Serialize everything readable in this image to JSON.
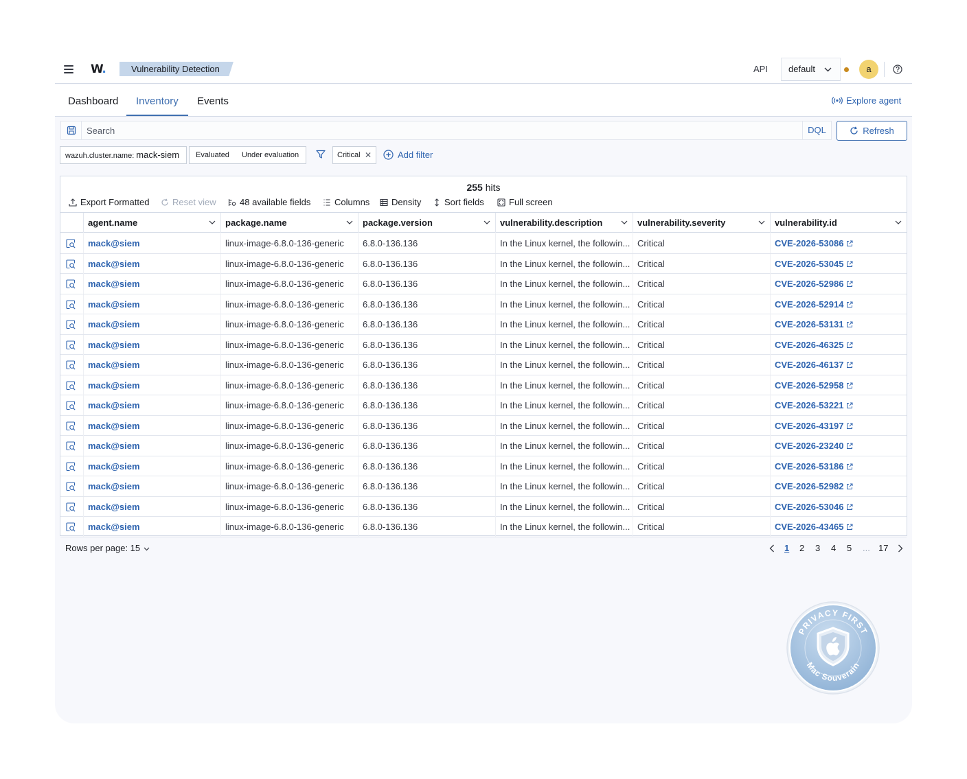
{
  "header": {
    "logo": "W",
    "breadcrumb": "Vulnerability Detection",
    "api_label": "API",
    "api_select": "default",
    "avatar_initial": "a"
  },
  "tabs": [
    {
      "label": "Dashboard"
    },
    {
      "label": "Inventory",
      "active": true
    },
    {
      "label": "Events"
    }
  ],
  "explore_agent": "Explore agent",
  "search": {
    "placeholder": "Search",
    "value": "",
    "language": "DQL"
  },
  "refresh_label": "Refresh",
  "filters": {
    "cluster_key": "wazuh.cluster.name:",
    "cluster_value": "mack-siem",
    "segment": [
      "Evaluated",
      "Under evaluation"
    ],
    "severity_pill": "Critical",
    "add_filter": "Add filter"
  },
  "grid": {
    "hits_count": "255",
    "hits_label": "hits",
    "toolbar": {
      "export": "Export Formatted",
      "reset": "Reset view",
      "fields": "48 available fields",
      "columns": "Columns",
      "density": "Density",
      "sort": "Sort fields",
      "fullscreen": "Full screen"
    },
    "columns": [
      "agent.name",
      "package.name",
      "package.version",
      "vulnerability.description",
      "vulnerability.severity",
      "vulnerability.id"
    ],
    "rows": [
      {
        "agent": "mack@siem",
        "package": "linux-image-6.8.0-136-generic",
        "version": "6.8.0-136.136",
        "description": "In the Linux kernel, the followin...",
        "severity": "Critical",
        "id": "CVE-2026-53086"
      },
      {
        "agent": "mack@siem",
        "package": "linux-image-6.8.0-136-generic",
        "version": "6.8.0-136.136",
        "description": "In the Linux kernel, the followin...",
        "severity": "Critical",
        "id": "CVE-2026-53045"
      },
      {
        "agent": "mack@siem",
        "package": "linux-image-6.8.0-136-generic",
        "version": "6.8.0-136.136",
        "description": "In the Linux kernel, the followin...",
        "severity": "Critical",
        "id": "CVE-2026-52986"
      },
      {
        "agent": "mack@siem",
        "package": "linux-image-6.8.0-136-generic",
        "version": "6.8.0-136.136",
        "description": "In the Linux kernel, the followin...",
        "severity": "Critical",
        "id": "CVE-2026-52914"
      },
      {
        "agent": "mack@siem",
        "package": "linux-image-6.8.0-136-generic",
        "version": "6.8.0-136.136",
        "description": "In the Linux kernel, the followin...",
        "severity": "Critical",
        "id": "CVE-2026-53131"
      },
      {
        "agent": "mack@siem",
        "package": "linux-image-6.8.0-136-generic",
        "version": "6.8.0-136.136",
        "description": "In the Linux kernel, the followin...",
        "severity": "Critical",
        "id": "CVE-2026-46325"
      },
      {
        "agent": "mack@siem",
        "package": "linux-image-6.8.0-136-generic",
        "version": "6.8.0-136.136",
        "description": "In the Linux kernel, the followin...",
        "severity": "Critical",
        "id": "CVE-2026-46137"
      },
      {
        "agent": "mack@siem",
        "package": "linux-image-6.8.0-136-generic",
        "version": "6.8.0-136.136",
        "description": "In the Linux kernel, the followin...",
        "severity": "Critical",
        "id": "CVE-2026-52958"
      },
      {
        "agent": "mack@siem",
        "package": "linux-image-6.8.0-136-generic",
        "version": "6.8.0-136.136",
        "description": "In the Linux kernel, the followin...",
        "severity": "Critical",
        "id": "CVE-2026-53221"
      },
      {
        "agent": "mack@siem",
        "package": "linux-image-6.8.0-136-generic",
        "version": "6.8.0-136.136",
        "description": "In the Linux kernel, the followin...",
        "severity": "Critical",
        "id": "CVE-2026-43197"
      },
      {
        "agent": "mack@siem",
        "package": "linux-image-6.8.0-136-generic",
        "version": "6.8.0-136.136",
        "description": "In the Linux kernel, the followin...",
        "severity": "Critical",
        "id": "CVE-2026-23240"
      },
      {
        "agent": "mack@siem",
        "package": "linux-image-6.8.0-136-generic",
        "version": "6.8.0-136.136",
        "description": "In the Linux kernel, the followin...",
        "severity": "Critical",
        "id": "CVE-2026-53186"
      },
      {
        "agent": "mack@siem",
        "package": "linux-image-6.8.0-136-generic",
        "version": "6.8.0-136.136",
        "description": "In the Linux kernel, the followin...",
        "severity": "Critical",
        "id": "CVE-2026-52982"
      },
      {
        "agent": "mack@siem",
        "package": "linux-image-6.8.0-136-generic",
        "version": "6.8.0-136.136",
        "description": "In the Linux kernel, the followin...",
        "severity": "Critical",
        "id": "CVE-2026-53046"
      },
      {
        "agent": "mack@siem",
        "package": "linux-image-6.8.0-136-generic",
        "version": "6.8.0-136.136",
        "description": "In the Linux kernel, the followin...",
        "severity": "Critical",
        "id": "CVE-2026-43465"
      }
    ]
  },
  "pagination": {
    "rows_per_page": "Rows per page: 15",
    "pages": [
      "1",
      "2",
      "3",
      "4",
      "5",
      "...",
      "17"
    ],
    "current": "1"
  },
  "seal": {
    "top_text": "PRIVACY FIRST",
    "bottom_text": "Mac Souverain"
  },
  "colors": {
    "accent": "#3065b0",
    "breadcrumb_bg": "#c5d6ea",
    "avatar_bg": "#f2d370",
    "status_dot": "#c98a1e"
  },
  "icons": [
    "menu-icon",
    "chevron-down-icon",
    "help-icon",
    "broadcast-icon",
    "save-query-icon",
    "refresh-icon",
    "filter-icon",
    "plus-circle-icon",
    "close-icon",
    "export-icon",
    "reset-icon",
    "fields-icon",
    "columns-icon",
    "density-icon",
    "sort-icon",
    "fullscreen-icon",
    "inspect-icon",
    "external-link-icon",
    "chevron-left-icon",
    "chevron-right-icon",
    "shield-apple-icon"
  ]
}
